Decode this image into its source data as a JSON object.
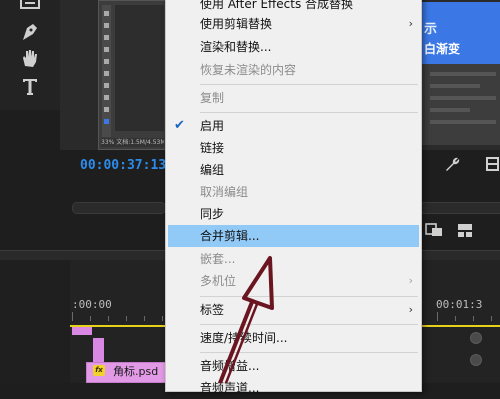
{
  "monitor": {
    "timecode": "00:00:37:13",
    "ps_thumb_status": "33%  文档:1.5M/4.53M"
  },
  "right_preview": {
    "line1": "示",
    "line2": "白渐变"
  },
  "timeline": {
    "ruler_start": ":00:00",
    "ruler_end": "00:01:3",
    "clip_label": "角标.psd",
    "fx_label": "fx"
  },
  "context_menu": {
    "items": [
      {
        "label": "使用 After Effects 合成替换",
        "enabled": true,
        "submenu": false
      },
      {
        "label": "使用剪辑替换",
        "enabled": true,
        "submenu": true
      },
      {
        "label": "渲染和替换...",
        "enabled": true,
        "submenu": false
      },
      {
        "label": "恢复未渲染的内容",
        "enabled": false,
        "submenu": false
      },
      {
        "label": "复制",
        "enabled": false,
        "submenu": false
      },
      {
        "label": "启用",
        "enabled": true,
        "submenu": false,
        "checked": true
      },
      {
        "label": "链接",
        "enabled": true,
        "submenu": false
      },
      {
        "label": "编组",
        "enabled": true,
        "submenu": false
      },
      {
        "label": "取消编组",
        "enabled": false,
        "submenu": false
      },
      {
        "label": "同步",
        "enabled": true,
        "submenu": false
      },
      {
        "label": "合并剪辑...",
        "enabled": true,
        "submenu": false,
        "highlighted": true
      },
      {
        "label": "嵌套...",
        "enabled": false,
        "submenu": false
      },
      {
        "label": "多机位",
        "enabled": false,
        "submenu": true
      },
      {
        "label": "标签",
        "enabled": true,
        "submenu": true
      },
      {
        "label": "速度/持续时间...",
        "enabled": true,
        "submenu": false
      },
      {
        "label": "音频增益...",
        "enabled": true,
        "submenu": false
      },
      {
        "label": "音频声道...",
        "enabled": true,
        "submenu": false
      }
    ],
    "submenu_glyph": "›",
    "check_glyph": "✔"
  },
  "colors": {
    "timecode": "#2d8ceb",
    "menu_highlight": "#91c9f7",
    "clip_pink": "#e39ae6",
    "playhead_yellow": "#e6d11b",
    "annotation_arrow": "#6b1520",
    "ps_blue": "#3b78e6"
  },
  "icons": [
    "scissors-icon",
    "pen-icon",
    "hand-icon",
    "type-icon",
    "wrench-icon",
    "settings-icon",
    "export-frame-icon",
    "insert-icon"
  ]
}
